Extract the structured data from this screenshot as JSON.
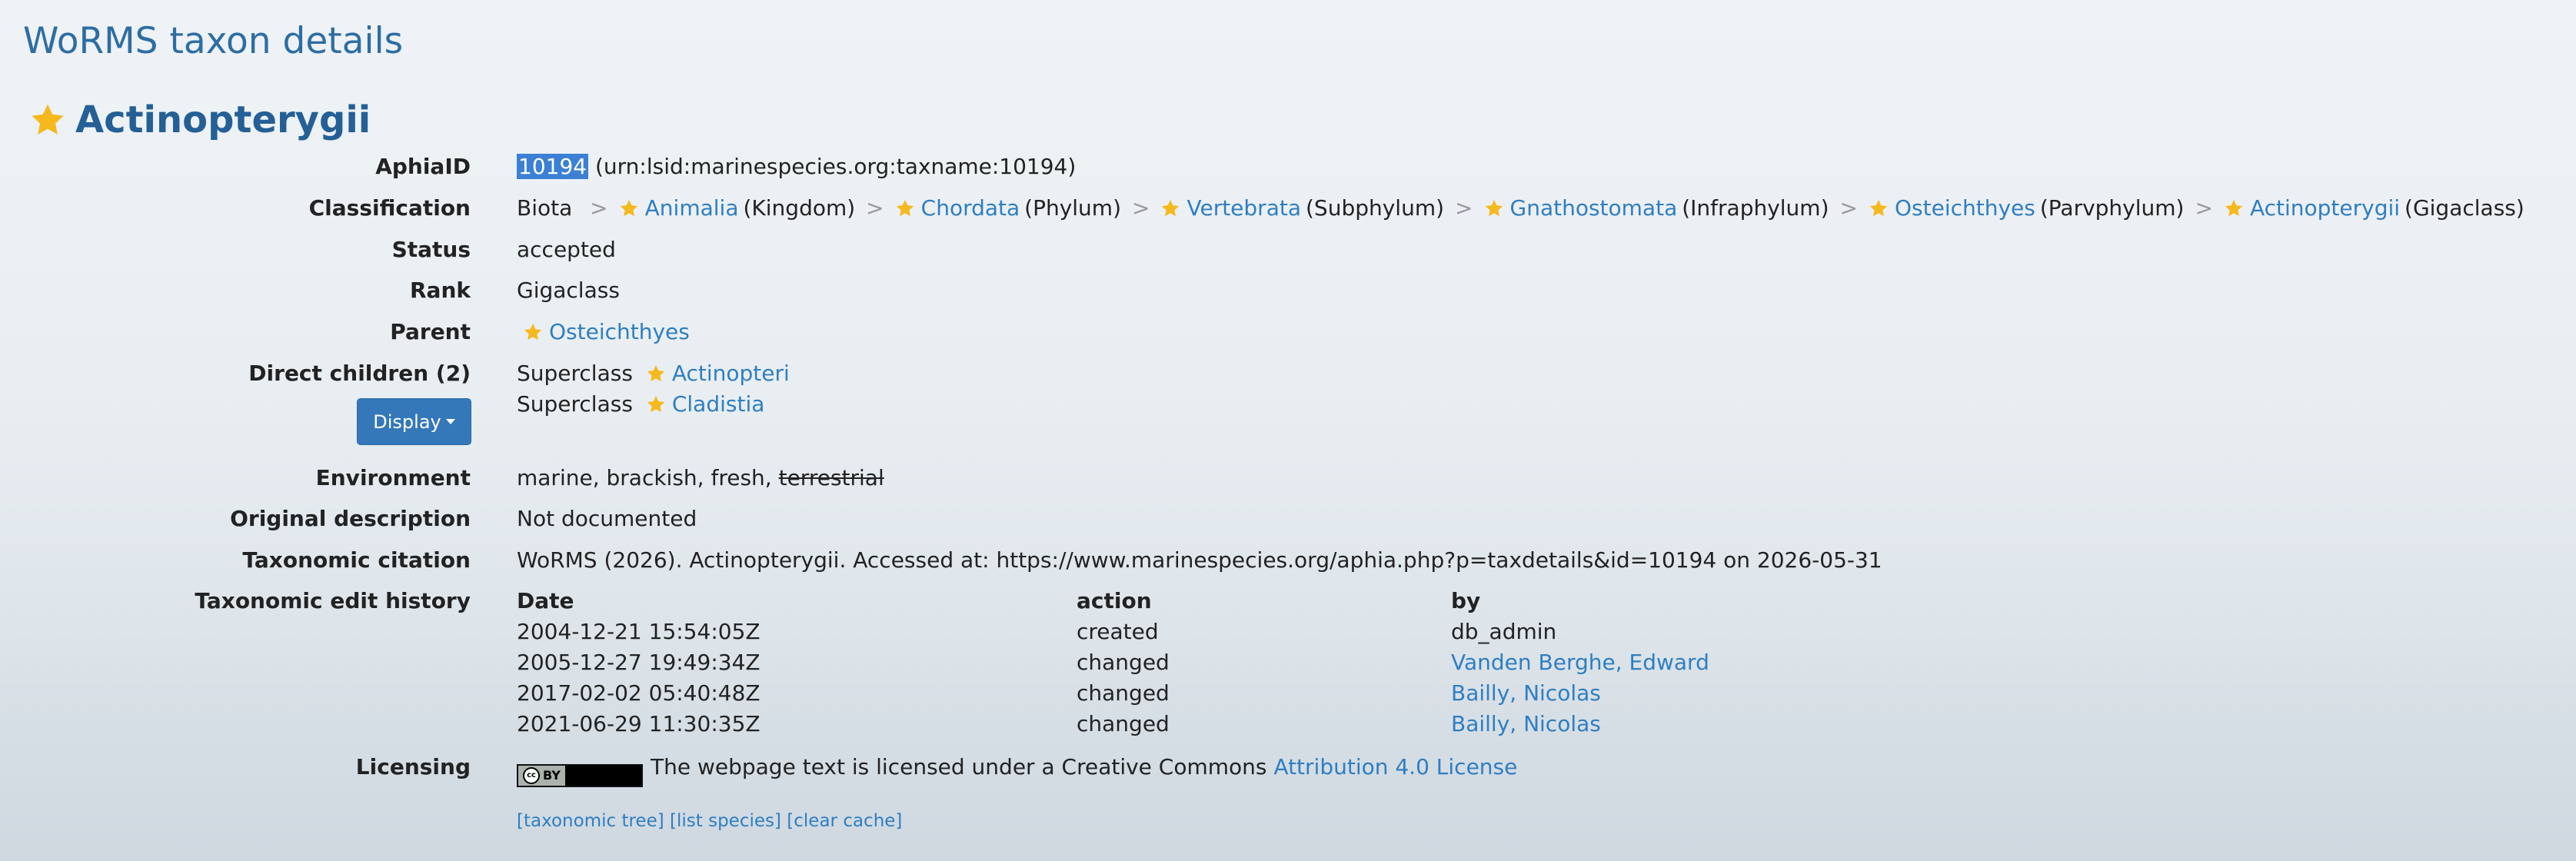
{
  "page_title": "WoRMS taxon details",
  "taxon_name": "Actinopterygii",
  "labels": {
    "aphia": "AphiaID",
    "classification": "Classification",
    "status": "Status",
    "rank": "Rank",
    "parent": "Parent",
    "children": "Direct children (2)",
    "environment": "Environment",
    "original_description": "Original description",
    "citation": "Taxonomic citation",
    "history": "Taxonomic edit history",
    "licensing": "Licensing"
  },
  "aphia": {
    "id": "10194",
    "lsid": "(urn:lsid:marinespecies.org:taxname:10194)"
  },
  "classification": {
    "root": "Biota",
    "items": [
      {
        "name": "Animalia",
        "rank": "(Kingdom)"
      },
      {
        "name": "Chordata",
        "rank": "(Phylum)"
      },
      {
        "name": "Vertebrata",
        "rank": "(Subphylum)"
      },
      {
        "name": "Gnathostomata",
        "rank": "(Infraphylum)"
      },
      {
        "name": "Osteichthyes",
        "rank": "(Parvphylum)"
      },
      {
        "name": "Actinopterygii",
        "rank": "(Gigaclass)"
      }
    ],
    "separator": ">"
  },
  "status": "accepted",
  "rank": "Gigaclass",
  "parent": "Osteichthyes",
  "children": [
    {
      "rank": "Superclass",
      "name": "Actinopteri"
    },
    {
      "rank": "Superclass",
      "name": "Cladistia"
    }
  ],
  "display_button": "Display",
  "environment": {
    "text": "marine, brackish, fresh,",
    "struck": "terrestrial"
  },
  "original_description": "Not documented",
  "citation": "WoRMS (2026). Actinopterygii. Accessed at: https://www.marinespecies.org/aphia.php?p=taxdetails&id=10194 on 2026-05-31",
  "history": {
    "headers": [
      "Date",
      "action",
      "by"
    ],
    "rows": [
      {
        "date": "2004-12-21 15:54:05Z",
        "action": "created",
        "by": "db_admin",
        "by_link": false
      },
      {
        "date": "2005-12-27 19:49:34Z",
        "action": "changed",
        "by": "Vanden Berghe, Edward",
        "by_link": true
      },
      {
        "date": "2017-02-02 05:40:48Z",
        "action": "changed",
        "by": "Bailly, Nicolas",
        "by_link": true
      },
      {
        "date": "2021-06-29 11:30:35Z",
        "action": "changed",
        "by": "Bailly, Nicolas",
        "by_link": true
      }
    ]
  },
  "licensing": {
    "badge_text": "BY",
    "badge_cc": "cc",
    "text": "The webpage text is licensed under a Creative Commons",
    "link": "Attribution 4.0 License"
  },
  "footer_links": [
    "[taxonomic tree]",
    "[list species]",
    "[clear cache]"
  ],
  "colors": {
    "link": "#2f7ec1",
    "title": "#2d6da3",
    "star": "#f5b91e",
    "button": "#3478b9",
    "selection": "#3b80d4"
  }
}
